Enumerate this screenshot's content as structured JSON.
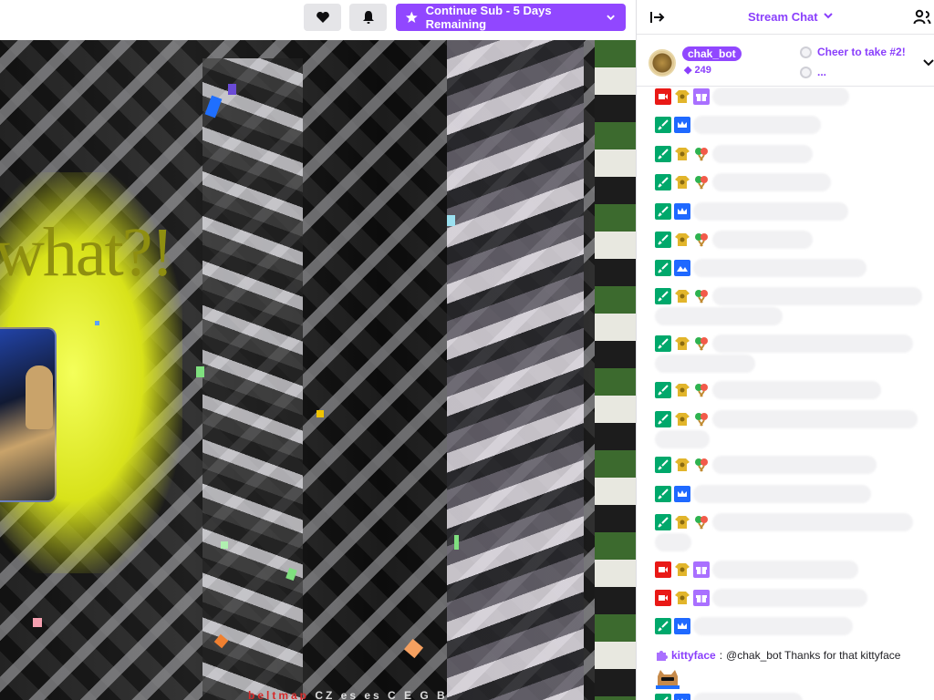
{
  "topbar": {
    "heart_icon": "heart-icon",
    "bell_icon": "bell-icon",
    "subscribe_button_label": "Continue Sub - 5 Days Remaining",
    "accent": "#9147ff"
  },
  "video": {
    "overlay_text": "what?!",
    "caption_red": "beltmap",
    "caption_rest": " CZ es es C E G B"
  },
  "sidebar": {
    "title": "Stream Chat",
    "pinned": {
      "username": "chak_bot",
      "bits": "249",
      "cheer_label": "Cheer to take #2!",
      "cheer_second": "..."
    },
    "last_message": {
      "username": "kittyface",
      "separator": ":",
      "text": " @chak_bot Thanks for that kittyface"
    }
  }
}
